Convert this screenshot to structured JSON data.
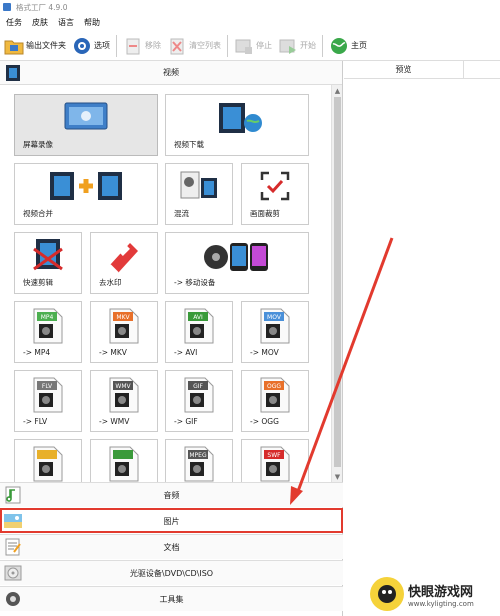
{
  "window": {
    "title": "格式工厂 4.9.0"
  },
  "menu": [
    "任务",
    "皮肤",
    "语言",
    "帮助"
  ],
  "toolbar": {
    "output_folder": "输出文件夹",
    "options": "选项",
    "remove": "移除",
    "clear_list": "清空列表",
    "stop": "停止",
    "start": "开始",
    "home": "主页"
  },
  "category": {
    "video": "视频"
  },
  "tiles": [
    {
      "label": "屏幕录像",
      "icon": "screen-record-icon"
    },
    {
      "label": "视频下载",
      "icon": "video-download-icon"
    },
    {
      "label": "视频合并",
      "icon": "video-merge-icon"
    },
    {
      "label": "混流",
      "icon": "mux-icon"
    },
    {
      "label": "画面裁剪",
      "icon": "crop-icon"
    },
    {
      "label": "快速剪辑",
      "icon": "quick-clip-icon"
    },
    {
      "label": "去水印",
      "icon": "remove-watermark-icon"
    },
    {
      "label": "-> 移动设备",
      "icon": "mobile-device-icon"
    },
    {
      "label": "-> MP4",
      "icon": "mp4-icon",
      "badge": "MP4",
      "badge_color": "#4caf50"
    },
    {
      "label": "-> MKV",
      "icon": "mkv-icon",
      "badge": "MKV",
      "badge_color": "#e8702a"
    },
    {
      "label": "-> AVI",
      "icon": "avi-icon",
      "badge": "AVI",
      "badge_color": "#3a9a3a"
    },
    {
      "label": "-> MOV",
      "icon": "mov-icon",
      "badge": "MOV",
      "badge_color": "#4a90d9"
    },
    {
      "label": "-> FLV",
      "icon": "flv-icon",
      "badge": "FLV",
      "badge_color": "#777777"
    },
    {
      "label": "-> WMV",
      "icon": "wmv-icon",
      "badge": "WMV",
      "badge_color": "#555555"
    },
    {
      "label": "-> GIF",
      "icon": "gif-icon",
      "badge": "GIF",
      "badge_color": "#555555"
    },
    {
      "label": "-> OGG",
      "icon": "ogg-icon",
      "badge": "OGG",
      "badge_color": "#e8702a"
    },
    {
      "label": "",
      "icon": "webm-icon",
      "badge": "",
      "badge_color": "#e8b02a"
    },
    {
      "label": "",
      "icon": "3gp-icon",
      "badge": "",
      "badge_color": "#3a9a3a"
    },
    {
      "label": "",
      "icon": "mpeg-icon",
      "badge": "MPEG",
      "badge_color": "#555555"
    },
    {
      "label": "",
      "icon": "swf-icon",
      "badge": "SWF",
      "badge_color": "#d62b2b"
    }
  ],
  "categories_bottom": [
    {
      "label": "音频",
      "icon": "audio-icon"
    },
    {
      "label": "图片",
      "icon": "picture-icon",
      "highlight": true
    },
    {
      "label": "文档",
      "icon": "document-icon"
    },
    {
      "label": "光驱设备\\DVD\\CD\\ISO",
      "icon": "disc-icon"
    },
    {
      "label": "工具集",
      "icon": "toolbox-icon"
    }
  ],
  "preview": {
    "header": "预览"
  },
  "watermark": {
    "title": "快眼游戏网",
    "url": "www.kyligting.com"
  },
  "colors": {
    "highlight": "#e23a2e",
    "arrow": "#e23a2e"
  }
}
